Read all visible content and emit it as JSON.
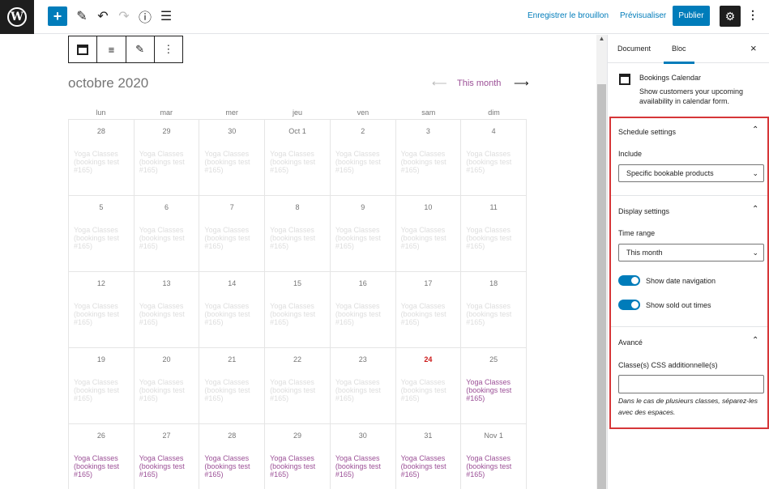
{
  "topbar": {
    "logo_letter": "W",
    "add_icon": "+",
    "edit_icon": "✎",
    "undo_icon": "↶",
    "redo_icon": "↷",
    "info_icon": "ⓘ",
    "list_icon": "☰",
    "save_draft": "Enregistrer le brouillon",
    "preview": "Prévisualiser",
    "publish": "Publier",
    "settings_icon": "⚙",
    "more_icon": "⋮"
  },
  "block_toolbar": {
    "align_icon": "≡",
    "edit_icon": "✎",
    "more_icon": "⋮"
  },
  "calendar": {
    "month": "octobre 2020",
    "prev_arrow": "⟵",
    "nav_label": "This month",
    "next_arrow": "⟶",
    "day_headers": [
      "lun",
      "mar",
      "mer",
      "jeu",
      "ven",
      "sam",
      "dim"
    ],
    "event_text": "Yoga Classes (bookings test #165)",
    "cells": [
      {
        "day": "28",
        "event": "Yoga Classes (bookings test #165)",
        "active": false
      },
      {
        "day": "29",
        "event": "Yoga Classes (bookings test #165)",
        "active": false
      },
      {
        "day": "30",
        "event": "Yoga Classes (bookings test #165)",
        "active": false
      },
      {
        "day": "Oct 1",
        "event": "Yoga Classes (bookings test #165)",
        "active": false
      },
      {
        "day": "2",
        "event": "Yoga Classes (bookings test #165)",
        "active": false
      },
      {
        "day": "3",
        "event": "Yoga Classes (bookings test #165)",
        "active": false
      },
      {
        "day": "4",
        "event": "Yoga Classes (bookings test #165)",
        "active": false
      },
      {
        "day": "5",
        "event": "Yoga Classes (bookings test #165)",
        "active": false
      },
      {
        "day": "6",
        "event": "Yoga Classes (bookings test #165)",
        "active": false
      },
      {
        "day": "7",
        "event": "Yoga Classes (bookings test #165)",
        "active": false
      },
      {
        "day": "8",
        "event": "Yoga Classes (bookings test #165)",
        "active": false
      },
      {
        "day": "9",
        "event": "Yoga Classes (bookings test #165)",
        "active": false
      },
      {
        "day": "10",
        "event": "Yoga Classes (bookings test #165)",
        "active": false
      },
      {
        "day": "11",
        "event": "Yoga Classes (bookings test #165)",
        "active": false
      },
      {
        "day": "12",
        "event": "Yoga Classes (bookings test #165)",
        "active": false
      },
      {
        "day": "13",
        "event": "Yoga Classes (bookings test #165)",
        "active": false
      },
      {
        "day": "14",
        "event": "Yoga Classes (bookings test #165)",
        "active": false
      },
      {
        "day": "15",
        "event": "Yoga Classes (bookings test #165)",
        "active": false
      },
      {
        "day": "16",
        "event": "Yoga Classes (bookings test #165)",
        "active": false
      },
      {
        "day": "17",
        "event": "Yoga Classes (bookings test #165)",
        "active": false
      },
      {
        "day": "18",
        "event": "Yoga Classes (bookings test #165)",
        "active": false
      },
      {
        "day": "19",
        "event": "Yoga Classes (bookings test #165)",
        "active": false
      },
      {
        "day": "20",
        "event": "Yoga Classes (bookings test #165)",
        "active": false
      },
      {
        "day": "21",
        "event": "Yoga Classes (bookings test #165)",
        "active": false
      },
      {
        "day": "22",
        "event": "Yoga Classes (bookings test #165)",
        "active": false
      },
      {
        "day": "23",
        "event": "Yoga Classes (bookings test #165)",
        "active": false
      },
      {
        "day": "24",
        "event": "Yoga Classes (bookings test #165)",
        "active": false,
        "today": true
      },
      {
        "day": "25",
        "event": "Yoga Classes (bookings test #165)",
        "active": true
      },
      {
        "day": "26",
        "event": "Yoga Classes (bookings test #165)",
        "active": true
      },
      {
        "day": "27",
        "event": "Yoga Classes (bookings test #165)",
        "active": true
      },
      {
        "day": "28",
        "event": "Yoga Classes (bookings test #165)",
        "active": true
      },
      {
        "day": "29",
        "event": "Yoga Classes (bookings test #165)",
        "active": true
      },
      {
        "day": "30",
        "event": "Yoga Classes (bookings test #165)",
        "active": true
      },
      {
        "day": "31",
        "event": "Yoga Classes (bookings test #165)",
        "active": true
      },
      {
        "day": "Nov 1",
        "event": "Yoga Classes (bookings test #165)",
        "active": true
      }
    ]
  },
  "sidebar": {
    "tab_document": "Document",
    "tab_block": "Bloc",
    "close_icon": "×",
    "block_name": "Bookings Calendar",
    "block_desc": "Show customers your upcoming availability in calendar form.",
    "schedule": {
      "title": "Schedule settings",
      "include_label": "Include",
      "include_value": "Specific bookable products"
    },
    "display": {
      "title": "Display settings",
      "time_range_label": "Time range",
      "time_range_value": "This month",
      "toggle_nav": "Show date navigation",
      "toggle_sold_out": "Show sold out times"
    },
    "advanced": {
      "title": "Avancé",
      "css_label": "Classe(s) CSS additionnelle(s)",
      "help": "Dans le cas de plusieurs classes, séparez-les avec des espaces."
    },
    "chevron_up": "⌃",
    "chevron_down": "⌄"
  },
  "colors": {
    "accent": "#007cba",
    "event_active": "#9b4f96",
    "today": "#cc1818",
    "highlight_border": "#d63638"
  }
}
